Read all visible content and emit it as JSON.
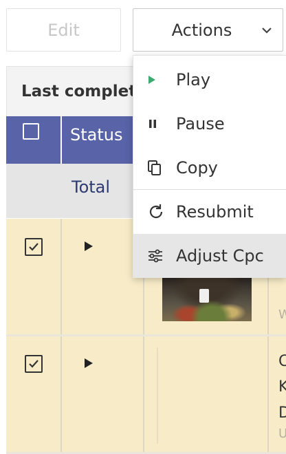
{
  "toolbar": {
    "edit_label": "Edit",
    "actions_label": "Actions"
  },
  "table": {
    "section_label": "Last complet",
    "header": {
      "status_label": "Status"
    },
    "total_label": "Total",
    "rows": [
      {
        "checked": true,
        "status": "play",
        "edge_text": "W"
      },
      {
        "checked": true,
        "status": "play",
        "edge_lines": [
          "C",
          "K",
          "D",
          "U"
        ]
      }
    ]
  },
  "menu": {
    "items": [
      {
        "label": "Play",
        "icon": "play-icon"
      },
      {
        "label": "Pause",
        "icon": "pause-icon"
      },
      {
        "label": "Copy",
        "icon": "copy-icon"
      },
      {
        "label": "Resubmit",
        "icon": "resubmit-icon"
      },
      {
        "label": "Adjust Cpc",
        "icon": "sliders-icon"
      }
    ]
  },
  "colors": {
    "header_bg": "#5863a8",
    "row_bg": "#f8ecc8",
    "play_green": "#3daa6f"
  }
}
